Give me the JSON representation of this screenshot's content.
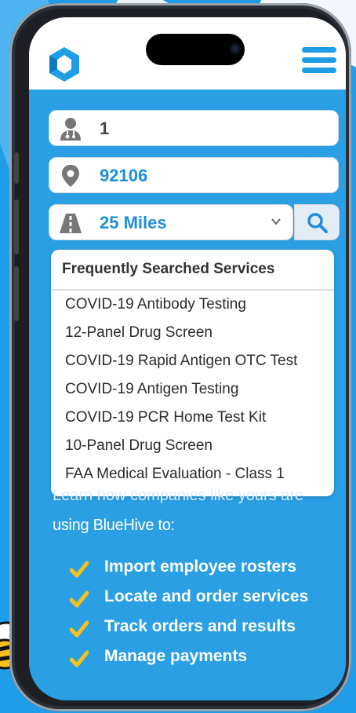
{
  "form": {
    "people_count": "1",
    "zip": "92106",
    "distance": "25 Miles"
  },
  "dropdown": {
    "heading": "Frequently Searched Services",
    "items": [
      "COVID-19 Antibody Testing",
      "12-Panel Drug Screen",
      "COVID-19 Rapid Antigen OTC Test",
      "COVID-19 Antigen Testing",
      "COVID-19 PCR Home Test Kit",
      "10-Panel Drug Screen",
      "FAA Medical Evaluation - Class 1"
    ]
  },
  "promo": {
    "line1_partial": "Learn how companies like yours are",
    "line2": "using BlueHive to:",
    "features": [
      "Import employee rosters",
      "Locate and order services",
      "Track orders and results",
      "Manage payments"
    ]
  },
  "icons": {
    "logo": "hexagon-logo-icon",
    "menu": "hamburger-menu-icon",
    "person": "doctor-icon",
    "location": "map-pin-icon",
    "road": "road-icon",
    "chevron": "chevron-down-icon",
    "search": "search-icon",
    "check": "checkmark-icon"
  },
  "colors": {
    "brand_blue": "#1d9ee6",
    "check_yellow": "#f5c21b",
    "background": "#2a9fe4"
  }
}
